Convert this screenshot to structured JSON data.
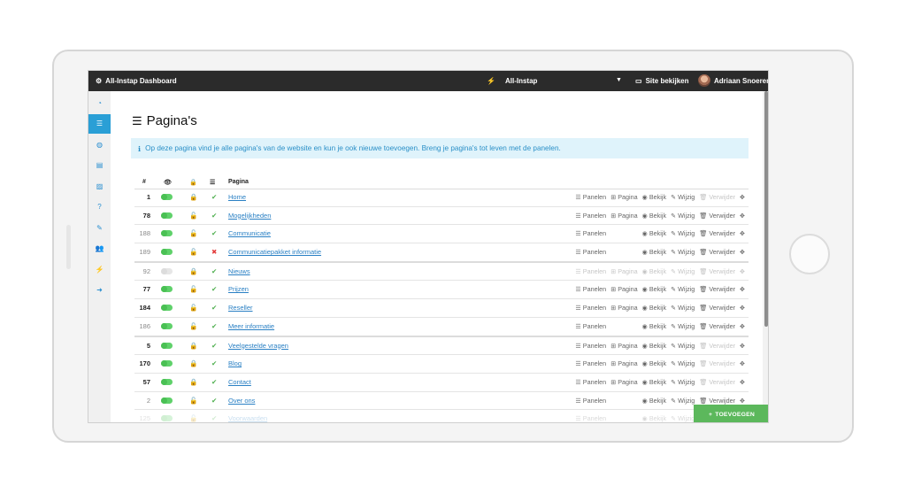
{
  "topbar": {
    "brand": "All-Instap Dashboard",
    "site_name": "All-Instap",
    "view_site": "Site bekijken",
    "user_name": "Adriaan Snoerer"
  },
  "sidebar": {
    "icons": [
      "dashboard-icon",
      "list-icon",
      "globe-icon",
      "file-icon",
      "image-icon",
      "question-icon",
      "edit-icon",
      "users-icon",
      "plug-icon",
      "arrow-right-icon"
    ],
    "active_index": 1
  },
  "page": {
    "title": "Pagina's",
    "info": "Op deze pagina vind je alle pagina's van de website en kun je ook nieuwe toevoegen. Breng je pagina's tot leven met de panelen.",
    "add_button": "TOEVOEGEN"
  },
  "table": {
    "headers": {
      "num": "#",
      "title": "Pagina"
    },
    "action_labels": {
      "panelen": "Panelen",
      "pagina": "Pagina",
      "bekijk": "Bekijk",
      "wijzig": "Wijzig",
      "verwijder": "Verwijder"
    },
    "rows": [
      {
        "num": "1",
        "strong": true,
        "active": true,
        "locked": true,
        "check": true,
        "title": "Home",
        "pagina": true,
        "deletable": false,
        "group_end": false
      },
      {
        "num": "78",
        "strong": true,
        "active": true,
        "locked": false,
        "check": true,
        "title": "Mogelijkheden",
        "pagina": true,
        "deletable": true,
        "group_end": false
      },
      {
        "num": "188",
        "strong": false,
        "active": true,
        "locked": false,
        "check": true,
        "title": "Communicatie",
        "pagina": false,
        "deletable": true,
        "group_end": false
      },
      {
        "num": "189",
        "strong": false,
        "active": true,
        "locked": false,
        "check": false,
        "title": "Communicatiepakket informatie",
        "pagina": false,
        "deletable": true,
        "group_end": true
      },
      {
        "num": "92",
        "strong": false,
        "active": false,
        "locked": true,
        "check": true,
        "title": "Nieuws",
        "pagina": true,
        "deletable": false,
        "group_end": false,
        "dim": true
      },
      {
        "num": "77",
        "strong": true,
        "active": true,
        "locked": false,
        "check": true,
        "title": "Prijzen",
        "pagina": true,
        "deletable": true,
        "group_end": false
      },
      {
        "num": "184",
        "strong": true,
        "active": true,
        "locked": false,
        "check": true,
        "title": "Reseller",
        "pagina": true,
        "deletable": true,
        "group_end": false
      },
      {
        "num": "186",
        "strong": false,
        "active": true,
        "locked": false,
        "check": true,
        "title": "Meer informatie",
        "pagina": false,
        "deletable": true,
        "group_end": true
      },
      {
        "num": "5",
        "strong": true,
        "active": true,
        "locked": true,
        "check": true,
        "title": "Veelgestelde vragen",
        "pagina": true,
        "deletable": false,
        "group_end": false
      },
      {
        "num": "170",
        "strong": true,
        "active": true,
        "locked": true,
        "check": true,
        "title": "Blog",
        "pagina": true,
        "deletable": false,
        "group_end": false
      },
      {
        "num": "57",
        "strong": true,
        "active": true,
        "locked": true,
        "check": true,
        "title": "Contact",
        "pagina": true,
        "deletable": false,
        "group_end": false
      },
      {
        "num": "2",
        "strong": false,
        "active": true,
        "locked": false,
        "check": true,
        "title": "Over ons",
        "pagina": false,
        "deletable": true,
        "group_end": false
      },
      {
        "num": "125",
        "strong": false,
        "active": true,
        "locked": false,
        "check": true,
        "title": "Voorwaarden",
        "pagina": false,
        "deletable": false,
        "group_end": false,
        "fade": true
      }
    ]
  },
  "colors": {
    "accent": "#2a9fd6",
    "topbar": "#2b2b2b",
    "add": "#5cb85c",
    "lock": "#e33b3b",
    "ok": "#4cae4c"
  }
}
